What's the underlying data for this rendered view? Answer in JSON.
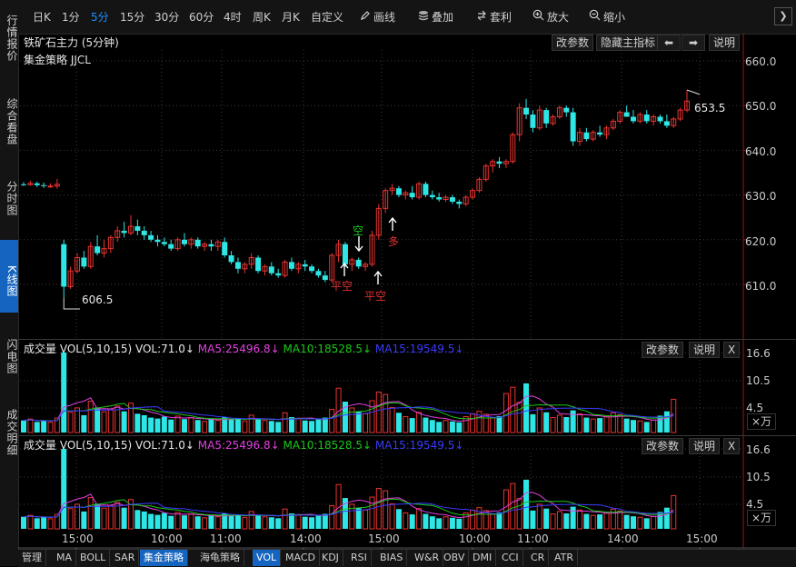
{
  "toolbar": {
    "periods": [
      "日K",
      "1分",
      "5分",
      "15分",
      "30分",
      "60分",
      "4时",
      "周K",
      "月K",
      "自定义"
    ],
    "active_period": "5分",
    "tools": [
      {
        "label": "画线",
        "icon": "pencil-icon"
      },
      {
        "label": "叠加",
        "icon": "stack-icon"
      },
      {
        "label": "套利",
        "icon": "arbitrage-icon"
      },
      {
        "label": "放大",
        "icon": "zoom-in-icon"
      },
      {
        "label": "缩小",
        "icon": "zoom-out-icon"
      }
    ],
    "next_label": "❯"
  },
  "leftnav": {
    "items": [
      "行情报价",
      "综合看盘",
      "分时图",
      "K线图",
      "闪电图",
      "成交明细"
    ],
    "active": "K线图"
  },
  "main": {
    "title": "铁矿石主力 (5分钟)",
    "strategy": "集金策略 JJCL",
    "buttons": [
      "改参数",
      "隐藏主指标",
      "⬅",
      "➡",
      "说明"
    ],
    "price_axis": [
      "660.0",
      "650.0",
      "640.0",
      "630.0",
      "620.0",
      "610.0"
    ],
    "last_price_label": "653.5",
    "low_price_label": "606.5",
    "signals": [
      {
        "text": "空",
        "color": "#19c919"
      },
      {
        "text": "平空",
        "color": "#e03030"
      },
      {
        "text": "平空",
        "color": "#e03030"
      },
      {
        "text": "多",
        "color": "#e03030"
      }
    ]
  },
  "volume_panes": [
    {
      "title": "成交量",
      "params": "VOL(5,10,15)",
      "vol": "VOL:71.0↓",
      "ma5": "MA5:25496.8↓",
      "ma10": "MA10:18528.5↓",
      "ma15": "MA15:19549.5↓",
      "buttons": [
        "改参数",
        "说明",
        "X"
      ],
      "axis": [
        "16.6",
        "10.5",
        "4.5"
      ],
      "unit": "×万"
    },
    {
      "title": "成交量",
      "params": "VOL(5,10,15)",
      "vol": "VOL:71.0↓",
      "ma5": "MA5:25496.8↓",
      "ma10": "MA10:18528.5↓",
      "ma15": "MA15:19549.5↓",
      "buttons": [
        "改参数",
        "说明",
        "X"
      ],
      "axis": [
        "16.6",
        "10.5",
        "4.5"
      ],
      "unit": "×万"
    }
  ],
  "time_axis": [
    "15:00",
    "10:00",
    "11:00",
    "14:00",
    "15:00",
    "10:00",
    "11:00",
    "14:00",
    "15:00"
  ],
  "bottom_tabs": [
    "管理",
    "MA",
    "BOLL",
    "SAR",
    "集金策略",
    "海龟策略",
    "VOL",
    "MACD",
    "KDJ",
    "RSI",
    "BIAS",
    "W&R",
    "OBV",
    "DMI",
    "CCI",
    "CR",
    "ATR"
  ],
  "bottom_active": [
    "集金策略",
    "VOL"
  ],
  "colors": {
    "up": "#e8332f",
    "down": "#2ee6e6",
    "ma5": "#e040e0",
    "ma10": "#19c919",
    "ma15": "#3a3aff",
    "accent": "#1565c0"
  },
  "chart_data": {
    "type": "candlestick",
    "ylim": [
      600,
      662
    ],
    "candles": [
      [
        632.4,
        632.9,
        632.0,
        632.3
      ],
      [
        632.3,
        633.2,
        632.1,
        632.6
      ],
      [
        632.6,
        633.0,
        631.8,
        632.2
      ],
      [
        632.2,
        632.8,
        631.6,
        632.0
      ],
      [
        632.0,
        632.6,
        631.6,
        632.0
      ],
      [
        632.0,
        633.6,
        631.4,
        632.4
      ],
      [
        619.0,
        620.0,
        607.0,
        609.5
      ],
      [
        609.5,
        614.0,
        609.0,
        613.0
      ],
      [
        613.0,
        617.0,
        612.5,
        616.0
      ],
      [
        616.0,
        617.5,
        613.5,
        614.0
      ],
      [
        614.0,
        619.5,
        613.5,
        618.5
      ],
      [
        618.5,
        621.0,
        616.5,
        617.0
      ],
      [
        617.0,
        620.0,
        616.0,
        618.0
      ],
      [
        618.0,
        621.0,
        617.0,
        620.5
      ],
      [
        620.5,
        623.0,
        619.5,
        622.0
      ],
      [
        622.0,
        624.0,
        620.5,
        621.5
      ],
      [
        621.5,
        625.5,
        621.0,
        623.0
      ],
      [
        623.0,
        624.5,
        621.0,
        622.0
      ],
      [
        622.0,
        623.0,
        620.0,
        621.0
      ],
      [
        621.0,
        622.0,
        619.5,
        620.0
      ],
      [
        620.0,
        621.0,
        618.5,
        619.5
      ],
      [
        619.5,
        620.5,
        618.5,
        619.0
      ],
      [
        619.0,
        620.0,
        617.5,
        618.0
      ],
      [
        618.0,
        620.5,
        617.5,
        620.0
      ],
      [
        620.0,
        621.5,
        618.5,
        619.0
      ],
      [
        619.0,
        620.5,
        618.0,
        620.0
      ],
      [
        620.0,
        620.5,
        618.0,
        618.5
      ],
      [
        618.5,
        619.5,
        617.5,
        619.0
      ],
      [
        619.0,
        620.0,
        617.5,
        618.5
      ],
      [
        618.5,
        620.0,
        617.5,
        619.5
      ],
      [
        619.5,
        620.5,
        616.0,
        616.5
      ],
      [
        616.5,
        617.5,
        614.5,
        615.0
      ],
      [
        615.0,
        616.0,
        612.5,
        613.5
      ],
      [
        613.5,
        615.0,
        612.5,
        614.5
      ],
      [
        614.5,
        617.0,
        613.5,
        616.0
      ],
      [
        616.0,
        616.5,
        612.5,
        613.0
      ],
      [
        613.0,
        614.5,
        612.0,
        614.0
      ],
      [
        614.0,
        615.0,
        612.0,
        612.5
      ],
      [
        612.5,
        613.5,
        611.5,
        612.0
      ],
      [
        612.0,
        615.5,
        611.5,
        615.0
      ],
      [
        615.0,
        616.0,
        613.0,
        613.5
      ],
      [
        613.5,
        615.0,
        612.5,
        614.5
      ],
      [
        614.5,
        615.5,
        613.0,
        614.0
      ],
      [
        614.0,
        614.5,
        612.5,
        613.0
      ],
      [
        613.0,
        613.5,
        611.5,
        612.0
      ],
      [
        612.0,
        613.0,
        610.5,
        611.0
      ],
      [
        611.0,
        617.0,
        610.5,
        616.5
      ],
      [
        616.5,
        620.0,
        615.0,
        619.0
      ],
      [
        619.0,
        619.5,
        614.0,
        614.5
      ],
      [
        614.5,
        616.0,
        613.0,
        615.5
      ],
      [
        615.5,
        616.0,
        613.5,
        614.0
      ],
      [
        614.0,
        615.0,
        613.0,
        614.5
      ],
      [
        614.5,
        622.0,
        614.0,
        621.0
      ],
      [
        621.0,
        628.0,
        620.0,
        627.0
      ],
      [
        627.0,
        631.5,
        626.0,
        631.0
      ],
      [
        631.0,
        632.5,
        630.0,
        631.5
      ],
      [
        631.5,
        632.0,
        629.5,
        630.0
      ],
      [
        630.0,
        631.0,
        629.0,
        630.5
      ],
      [
        630.5,
        632.0,
        629.0,
        629.5
      ],
      [
        629.5,
        633.0,
        629.0,
        632.5
      ],
      [
        632.5,
        633.0,
        629.5,
        630.0
      ],
      [
        630.0,
        631.0,
        629.0,
        629.5
      ],
      [
        629.5,
        630.5,
        628.5,
        629.0
      ],
      [
        629.0,
        630.0,
        628.5,
        629.5
      ],
      [
        629.5,
        630.0,
        628.0,
        628.5
      ],
      [
        628.5,
        629.0,
        627.0,
        628.0
      ],
      [
        628.0,
        630.0,
        627.5,
        629.5
      ],
      [
        629.5,
        631.5,
        629.0,
        631.0
      ],
      [
        631.0,
        634.0,
        630.5,
        633.5
      ],
      [
        633.5,
        637.0,
        633.0,
        636.5
      ],
      [
        636.5,
        638.0,
        635.0,
        637.5
      ],
      [
        637.5,
        638.5,
        636.0,
        637.0
      ],
      [
        637.0,
        638.0,
        636.0,
        637.5
      ],
      [
        637.5,
        644.0,
        637.0,
        643.5
      ],
      [
        643.5,
        650.5,
        642.0,
        649.5
      ],
      [
        649.5,
        651.5,
        647.0,
        648.0
      ],
      [
        648.0,
        649.0,
        644.0,
        645.0
      ],
      [
        645.0,
        650.0,
        644.5,
        649.0
      ],
      [
        649.0,
        649.5,
        645.0,
        646.0
      ],
      [
        646.0,
        648.0,
        645.5,
        647.5
      ],
      [
        647.5,
        650.0,
        647.0,
        649.5
      ],
      [
        649.5,
        650.0,
        647.5,
        648.5
      ],
      [
        648.5,
        649.5,
        641.0,
        642.0
      ],
      [
        642.0,
        645.0,
        641.0,
        644.0
      ],
      [
        644.0,
        645.0,
        642.0,
        642.5
      ],
      [
        642.5,
        644.5,
        642.0,
        644.0
      ],
      [
        644.0,
        645.5,
        643.0,
        643.5
      ],
      [
        643.5,
        645.5,
        642.5,
        645.0
      ],
      [
        645.0,
        647.0,
        644.5,
        646.5
      ],
      [
        646.5,
        649.0,
        646.0,
        648.5
      ],
      [
        648.5,
        650.0,
        647.5,
        647.5
      ],
      [
        647.5,
        649.0,
        646.0,
        646.5
      ],
      [
        646.5,
        648.5,
        646.0,
        648.0
      ],
      [
        648.0,
        649.0,
        646.0,
        646.5
      ],
      [
        646.5,
        648.0,
        645.5,
        647.5
      ],
      [
        647.5,
        648.0,
        646.0,
        646.5
      ],
      [
        646.5,
        648.0,
        645.0,
        645.5
      ],
      [
        645.5,
        647.5,
        645.0,
        647.0
      ],
      [
        647.0,
        649.5,
        646.5,
        649.0
      ],
      [
        649.0,
        653.5,
        648.5,
        651.0
      ]
    ],
    "volume": [
      2.5,
      2.8,
      2.2,
      2.4,
      2.1,
      3.0,
      16.6,
      4.2,
      5.1,
      3.6,
      6.5,
      5.2,
      4.3,
      4.9,
      5.5,
      4.4,
      6.1,
      3.9,
      3.6,
      3.1,
      2.9,
      3.3,
      2.7,
      3.4,
      2.8,
      3.1,
      2.6,
      2.3,
      2.9,
      2.5,
      3.2,
      2.7,
      2.9,
      2.4,
      3.6,
      2.8,
      2.5,
      2.4,
      2.2,
      4.1,
      3.2,
      2.9,
      2.5,
      2.4,
      2.8,
      3.1,
      4.8,
      9.2,
      6.4,
      5.1,
      4.3,
      3.9,
      6.6,
      8.4,
      7.9,
      5.2,
      4.1,
      3.3,
      3.0,
      4.2,
      3.1,
      2.6,
      2.2,
      2.5,
      2.3,
      2.1,
      3.3,
      3.9,
      4.4,
      3.8,
      3.1,
      3.4,
      8.1,
      9.4,
      6.3,
      10.2,
      3.8,
      5.1,
      4.2,
      3.1,
      3.6,
      3.2,
      4.6,
      3.9,
      3.1,
      2.8,
      3.0,
      3.3,
      4.1,
      3.7,
      2.9,
      2.6,
      2.4,
      2.2,
      2.6,
      3.5,
      4.4,
      6.9
    ],
    "x_tick_labels": [
      "15:00",
      "10:00",
      "11:00",
      "14:00",
      "15:00",
      "10:00",
      "11:00",
      "14:00",
      "15:00"
    ]
  }
}
